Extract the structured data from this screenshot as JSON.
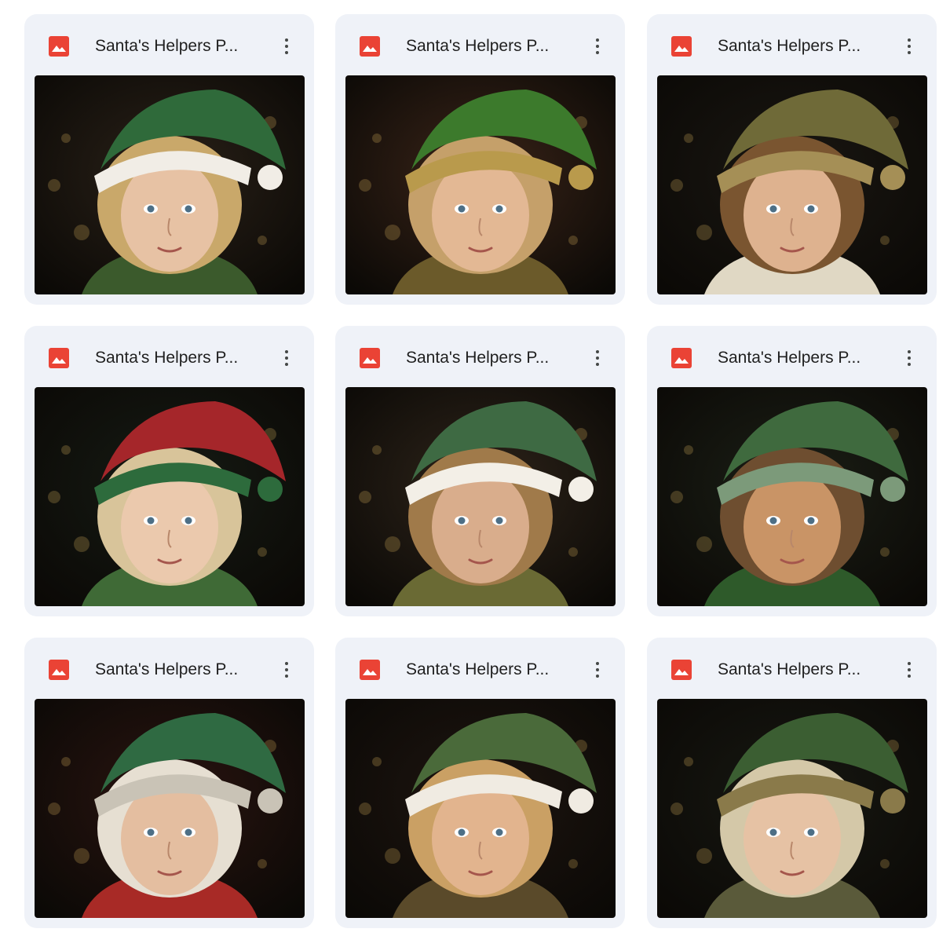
{
  "files": [
    {
      "name": "Santa's Helpers P...",
      "icon": "image-file-icon",
      "hat": "#2f6a3a",
      "trim": "#f1ede6",
      "hair": "#c9a86a",
      "bg": "#2a2118",
      "skin": "#e7c2a4",
      "outfit": "#3b5a2c"
    },
    {
      "name": "Santa's Helpers P...",
      "icon": "image-file-icon",
      "hat": "#3c7a2c",
      "trim": "#b99a4c",
      "hair": "#c5a06a",
      "bg": "#3a2418",
      "skin": "#e3b894",
      "outfit": "#6b5a2a"
    },
    {
      "name": "Santa's Helpers P...",
      "icon": "image-file-icon",
      "hat": "#6f6a38",
      "trim": "#a58f56",
      "hair": "#7a5530",
      "bg": "#1a1712",
      "skin": "#deb28f",
      "outfit": "#e0d8c4"
    },
    {
      "name": "Santa's Helpers P...",
      "icon": "image-file-icon",
      "hat": "#a5262a",
      "trim": "#2d6b3c",
      "hair": "#d8c49a",
      "bg": "#161b14",
      "skin": "#ebc9ad",
      "outfit": "#3f6a36"
    },
    {
      "name": "Santa's Helpers P...",
      "icon": "image-file-icon",
      "hat": "#3e6a43",
      "trim": "#f3efe7",
      "hair": "#a07a4a",
      "bg": "#2e241a",
      "skin": "#d9ad8c",
      "outfit": "#6a6a34"
    },
    {
      "name": "Santa's Helpers P...",
      "icon": "image-file-icon",
      "hat": "#3f6a3e",
      "trim": "#7c9a7a",
      "hair": "#6e4e30",
      "bg": "#1b1f16",
      "skin": "#c99466",
      "outfit": "#2e5a2a"
    },
    {
      "name": "Santa's Helpers P...",
      "icon": "image-file-icon",
      "hat": "#2f6a42",
      "trim": "#c9c3b6",
      "hair": "#e6dfd2",
      "bg": "#2a1410",
      "skin": "#e4bea0",
      "outfit": "#a82a26"
    },
    {
      "name": "Santa's Helpers P...",
      "icon": "image-file-icon",
      "hat": "#4a6a3a",
      "trim": "#f0ebe2",
      "hair": "#caa064",
      "bg": "#1e1510",
      "skin": "#e2b48e",
      "outfit": "#5a4a2a"
    },
    {
      "name": "Santa's Helpers P...",
      "icon": "image-file-icon",
      "hat": "#3b5e32",
      "trim": "#8a7a4a",
      "hair": "#d4c8a8",
      "bg": "#171812",
      "skin": "#e6c2a4",
      "outfit": "#5a5a3a"
    }
  ],
  "colors": {
    "card_bg": "#eff2f8",
    "icon_red": "#ea4335",
    "text": "#1f1f1f",
    "menu_dots": "#444746"
  }
}
